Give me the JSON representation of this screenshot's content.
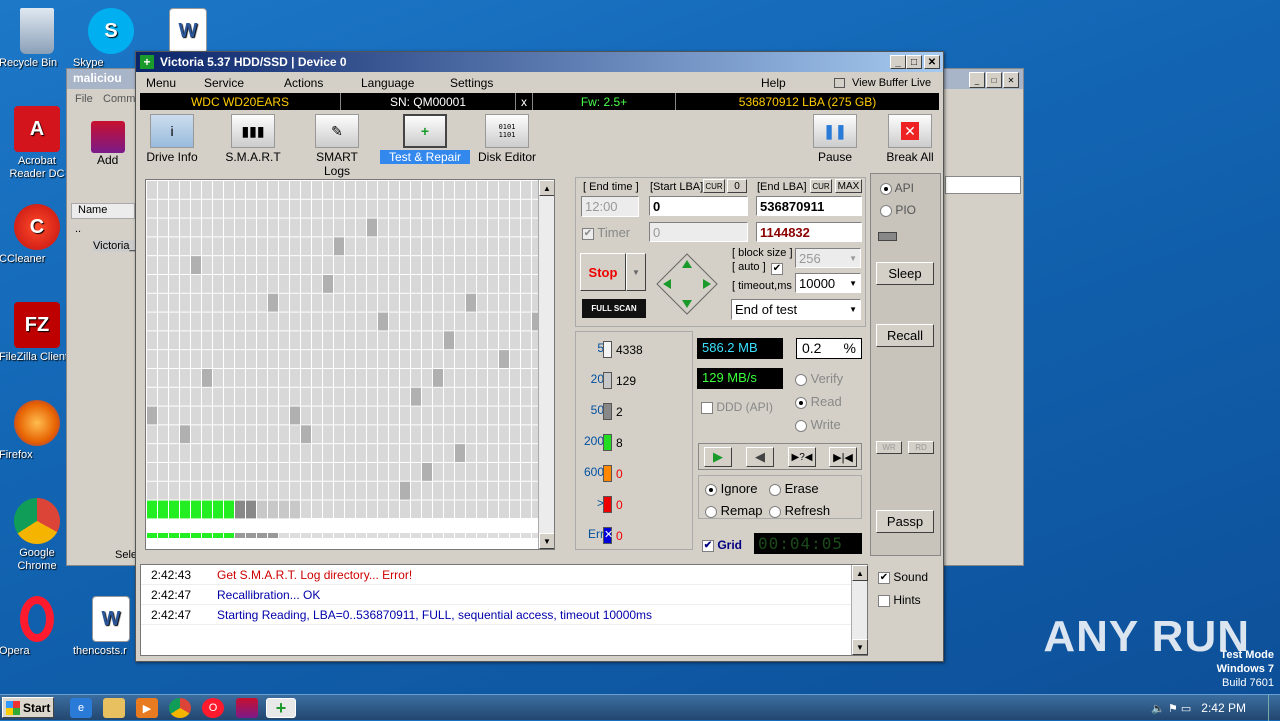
{
  "desktop": {
    "icons": [
      {
        "name": "recycle-bin",
        "label": "Recycle Bin"
      },
      {
        "name": "skype",
        "label": "Skype"
      },
      {
        "name": "acrobat",
        "label": "Acrobat Reader DC"
      },
      {
        "name": "ccleaner",
        "label": "CCleaner"
      },
      {
        "name": "filezilla",
        "label": "FileZilla Client"
      },
      {
        "name": "firefox",
        "label": "Firefox"
      },
      {
        "name": "chrome",
        "label": "Google Chrome"
      },
      {
        "name": "opera",
        "label": "Opera"
      },
      {
        "name": "thencosts",
        "label": "thencosts.r"
      }
    ],
    "watermark": "ANY RUN",
    "testmode": [
      "Test Mode",
      "Windows 7",
      "Build 7601"
    ]
  },
  "taskbar": {
    "start": "Start",
    "time": "2:42 PM"
  },
  "bgwindow": {
    "title": "maliciou",
    "menu": [
      "File",
      "Comma"
    ],
    "add": "Add",
    "col_name": "Name",
    "rows": [
      "..",
      "Victoria_"
    ],
    "status": "Sele"
  },
  "app": {
    "title": "Victoria 5.37 HDD/SSD | Device 0",
    "menu": [
      "Menu",
      "Service",
      "Actions",
      "Language",
      "Settings",
      "Help",
      "View Buffer Live"
    ],
    "info": {
      "model": "WDC WD20EARS",
      "serial": "SN: QM00001",
      "close": "x",
      "fw": "Fw: 2.5+",
      "lba": "536870912 LBA (275 GB)"
    },
    "toolbar": [
      "Drive Info",
      "S.M.A.R.T",
      "SMART Logs",
      "Test & Repair",
      "Disk Editor",
      "Pause",
      "Break All"
    ],
    "scan": {
      "end_time_label": "[ End time ]",
      "start_lba_label": "[Start LBA]",
      "cur": "CUR",
      "zero": "0",
      "end_lba_label": "[End LBA]",
      "cur2": "CUR",
      "max": "MAX",
      "time": "12:00",
      "start_lba": "0",
      "end_lba": "536870911",
      "timer": "Timer",
      "timer_val": "0",
      "current_lba": "1144832",
      "stop": "Stop",
      "block_size_label": "[ block size ]",
      "auto_label": "[ auto ]",
      "block_size": "256",
      "timeout_label": "[ timeout,ms ]",
      "timeout": "10000",
      "full_scan": "FULL SCAN",
      "end_of_test": "End of test"
    },
    "legend": [
      {
        "ms": "5",
        "count": "4338",
        "color": "#f4f4f4"
      },
      {
        "ms": "20",
        "count": "129",
        "color": "#c8c8c8"
      },
      {
        "ms": "50",
        "count": "2",
        "color": "#888888"
      },
      {
        "ms": "200",
        "count": "8",
        "color": "#22dd22"
      },
      {
        "ms": "600",
        "count": "0",
        "color": "#ff8800"
      },
      {
        "ms": ">",
        "count": "0",
        "color": "#ee0000"
      },
      {
        "ms": "Err",
        "count": "0",
        "color": "#0000dd"
      }
    ],
    "stats": {
      "mb": "586.2 MB",
      "pct": "0.2",
      "pct_sign": "%",
      "speed": "129 MB/s",
      "ddd": "DDD (API)",
      "verify": "Verify",
      "read": "Read",
      "write": "Write"
    },
    "options": {
      "ignore": "Ignore",
      "erase": "Erase",
      "remap": "Remap",
      "refresh": "Refresh",
      "grid": "Grid",
      "elapsed": "00:04:05"
    },
    "side": {
      "api": "API",
      "pio": "PIO",
      "sleep": "Sleep",
      "recall": "Recall",
      "wr": "WR",
      "rd": "RD",
      "passp": "Passp",
      "sound": "Sound",
      "hints": "Hints"
    },
    "log": [
      {
        "time": "2:42:43",
        "msg": "Get S.M.A.R.T. Log directory... Error!",
        "color": "#cc0000"
      },
      {
        "time": "2:42:47",
        "msg": "Recallibration... OK",
        "color": "#0000aa"
      },
      {
        "time": "2:42:47",
        "msg": "Starting Reading, LBA=0..536870911, FULL, sequential access, timeout 10000ms",
        "color": "#0000aa"
      }
    ]
  }
}
